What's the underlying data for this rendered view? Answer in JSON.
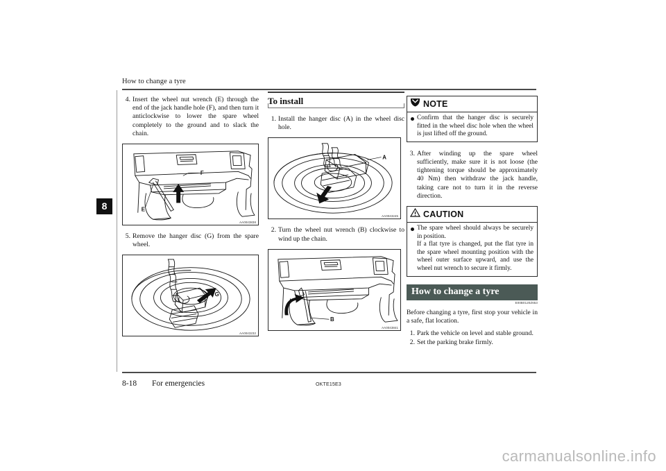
{
  "document": {
    "running_header": "How to change a tyre",
    "chapter_tab": "8",
    "footer": {
      "page_number": "8-18",
      "section": "For emergencies",
      "doc_code": "OKTE15E3"
    },
    "watermark": "carmanualsonline.info"
  },
  "column1": {
    "step4": {
      "num": "4.",
      "text": "Insert the wheel nut wrench (E) through the end of the jack handle hole (F), and then turn it anticlockwise to lower the spare wheel completely to the ground and to slack the chain."
    },
    "figure1": {
      "code": "AA0043838",
      "labels": {
        "e": "E",
        "f": "F"
      },
      "alt": "Rear underbody of vehicle showing wheel nut wrench inserted into jack handle hole"
    },
    "step5": {
      "num": "5.",
      "text": "Remove the hanger disc (G) from the spare wheel."
    },
    "figure2": {
      "code": "AA0043232",
      "labels": {
        "g": "G"
      },
      "alt": "Spare wheel with hanger disc and chain being removed"
    }
  },
  "column2": {
    "section_heading": "To install",
    "step1": {
      "num": "1.",
      "text": "Install the hanger disc (A) in the wheel disc hole."
    },
    "figure3": {
      "code": "AA0043245",
      "labels": {
        "a": "A"
      },
      "alt": "Hanger disc being inserted into wheel disc hole"
    },
    "step2": {
      "num": "2.",
      "text": "Turn the wheel nut wrench (B) clockwise to wind up the chain."
    },
    "figure4": {
      "code": "AA0043841",
      "labels": {
        "b": "B"
      },
      "alt": "Rear underbody showing wheel nut wrench turned clockwise"
    }
  },
  "column3": {
    "note": {
      "title": "NOTE",
      "icon": "note-icon",
      "bullet": "Confirm that the hanger disc is securely fitted in the wheel disc hole when the wheel is just lifted off the ground."
    },
    "step3": {
      "num": "3.",
      "text": "After winding up the spare wheel sufficiently, make sure it is not loose (the tightening torque should be approximately 40 Nm) then withdraw the jack handle, taking care not to turn it in the reverse direction."
    },
    "caution": {
      "title": "CAUTION",
      "icon": "warning-triangle-icon",
      "bullet_line1": "The spare wheel should always be securely in position.",
      "bullet_line2": "If a flat tyre is changed, put the flat tyre in the spare wheel mounting position with the wheel outer surface upward, and use the wheel nut wrench to secure it firmly."
    },
    "banner": {
      "title": "How to change a tyre",
      "code": "E00B0120Z653",
      "accent_color": "#4b5a56"
    },
    "intro": "Before changing a tyre, first stop your vehicle in a safe, flat location.",
    "steps": [
      {
        "num": "1.",
        "text": "Park the vehicle on level and stable ground."
      },
      {
        "num": "2.",
        "text": "Set the parking brake firmly."
      }
    ]
  }
}
